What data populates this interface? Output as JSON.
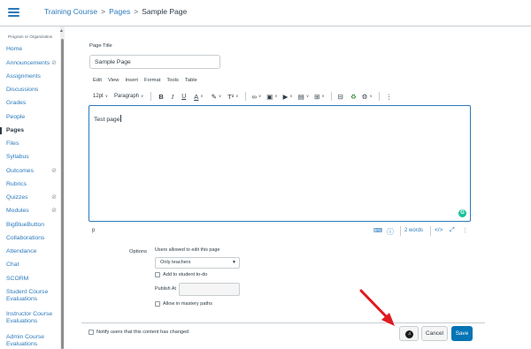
{
  "header": {
    "breadcrumbs": [
      "Training Course",
      "Pages",
      "Sample Page"
    ],
    "separator": ">"
  },
  "sidebar": {
    "org_label": "Program or Organization",
    "items": [
      {
        "label": "Home",
        "hidden": false
      },
      {
        "label": "Announcements",
        "hidden": true
      },
      {
        "label": "Assignments",
        "hidden": false
      },
      {
        "label": "Discussions",
        "hidden": false
      },
      {
        "label": "Grades",
        "hidden": false
      },
      {
        "label": "People",
        "hidden": false
      },
      {
        "label": "Pages",
        "hidden": false,
        "active": true
      },
      {
        "label": "Files",
        "hidden": false
      },
      {
        "label": "Syllabus",
        "hidden": false
      },
      {
        "label": "Outcomes",
        "hidden": true
      },
      {
        "label": "Rubrics",
        "hidden": false
      },
      {
        "label": "Quizzes",
        "hidden": true
      },
      {
        "label": "Modules",
        "hidden": true
      },
      {
        "label": "BigBlueButton",
        "hidden": false
      },
      {
        "label": "Collaborations",
        "hidden": false
      },
      {
        "label": "Attendance",
        "hidden": false
      },
      {
        "label": "Chat",
        "hidden": false
      },
      {
        "label": "SCORM",
        "hidden": false
      },
      {
        "label": "Student Course Evaluations",
        "hidden": false
      },
      {
        "label": "Instructor Course Evaluations",
        "hidden": false
      },
      {
        "label": "Admin Course Evaluations",
        "hidden": false
      }
    ]
  },
  "page_title": {
    "label": "Page Title",
    "value": "Sample Page"
  },
  "editor": {
    "menu": [
      "Edit",
      "View",
      "Insert",
      "Format",
      "Tools",
      "Table"
    ],
    "font_size": "12pt",
    "block_format": "Paragraph",
    "content": "Test page",
    "path": "p",
    "word_count": "2 words"
  },
  "options": {
    "label": "Options",
    "edit_title": "Users allowed to edit this page",
    "edit_selected": "Only teachers",
    "add_todo": "Add to student to-do",
    "publish_at": "Publish At",
    "mastery_paths": "Allow in mastery paths"
  },
  "footer": {
    "notify": "Notify users that this content has changed",
    "cancel": "Cancel",
    "save": "Save"
  },
  "colors": {
    "link": "#2b7abc",
    "primary_button": "#0374b5",
    "annotation_arrow": "#e0191f",
    "grammarly": "#15c39a"
  },
  "icons": {
    "menu": "hamburger-icon",
    "hidden": "eye-slash-icon",
    "sound": "soundtrap-icon",
    "grammarly": "grammarly-icon"
  }
}
